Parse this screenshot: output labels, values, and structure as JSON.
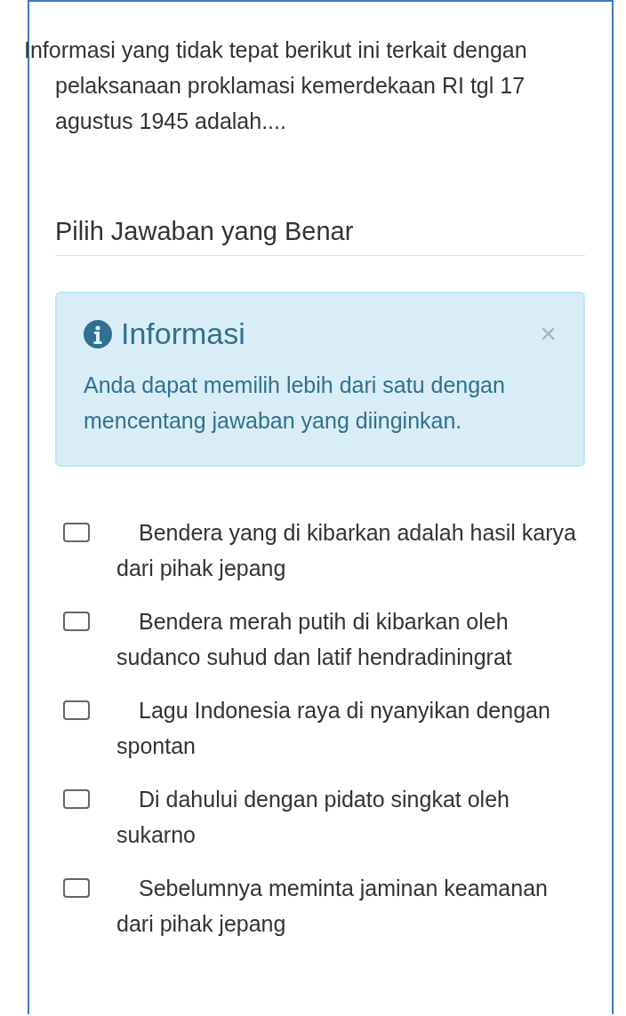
{
  "question": "Informasi yang tidak tepat berikut ini terkait dengan pelaksanaan proklamasi kemerdekaan RI tgl 17 agustus 1945 adalah....",
  "prompt": "Pilih Jawaban yang Benar",
  "alert": {
    "title": "Informasi",
    "close": "×",
    "message": "Anda dapat memilih lebih dari satu dengan mencentang jawaban yang diinginkan."
  },
  "options": [
    {
      "text": "Bendera yang di kibarkan adalah hasil karya dari pihak jepang",
      "checked": false
    },
    {
      "text": "Bendera merah putih di kibarkan oleh sudanco suhud dan latif hendradiningrat",
      "checked": false
    },
    {
      "text": "Lagu Indonesia raya di nyanyikan dengan spontan",
      "checked": false
    },
    {
      "text": "Di dahului dengan pidato singkat oleh sukarno",
      "checked": false
    },
    {
      "text": "Sebelumnya meminta jaminan keamanan dari pihak jepang",
      "checked": false
    }
  ]
}
